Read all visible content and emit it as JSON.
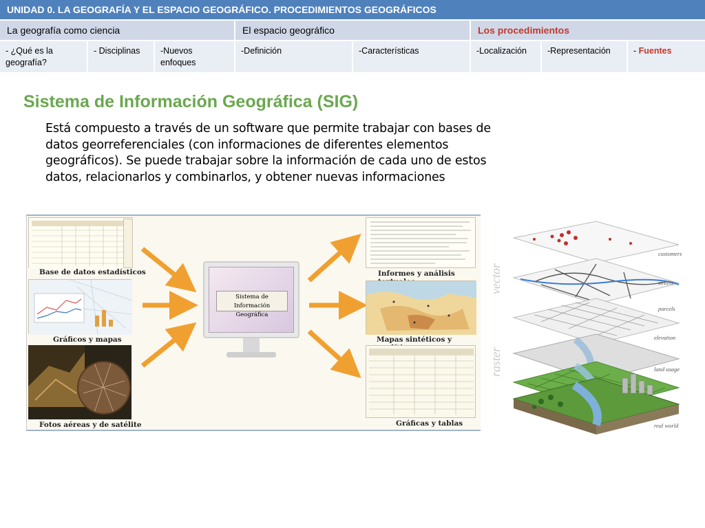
{
  "header": {
    "unit_title": "UNIDAD 0.  LA GEOGRAFÍA Y EL ESPACIO GEOGRÁFICO. PROCEDIMIENTOS GEOGRÁFICOS"
  },
  "sections": [
    {
      "label": "La geografía como ciencia"
    },
    {
      "label": "El espacio geográfico"
    },
    {
      "label": "Los procedimientos",
      "active": true
    }
  ],
  "subsections": [
    {
      "label": "- ¿Qué es la geografía?"
    },
    {
      "label": "- Disciplinas"
    },
    {
      "label": "-Nuevos enfoques"
    },
    {
      "label": "-Definición"
    },
    {
      "label": "-Características"
    },
    {
      "label": "-Localización"
    },
    {
      "label": "-Representación"
    },
    {
      "prefix": "- ",
      "label": "Fuentes",
      "active": true
    }
  ],
  "main": {
    "title": "Sistema de Información Geográfica (SIG)",
    "paragraph": "Está compuesto a través de un software que permite trabajar con bases de datos georreferenciales (con informaciones de diferentes elementos geográficos). Se puede trabajar sobre la información de cada uno de estos datos, relacionarlos y combinarlos, y obtener nuevas informaciones"
  },
  "diagram": {
    "center_label_line1": "Sistema de",
    "center_label_line2": "Información Geográfica",
    "inputs": [
      "Base de datos estadísticos",
      "Gráficos y mapas",
      "Fotos aéreas y de satélite"
    ],
    "outputs": [
      "Informes y análisis textuales",
      "Mapas sintéticos y analíticos",
      "Gráficas y tablas"
    ]
  },
  "layers": {
    "side_labels": [
      "vector",
      "raster"
    ],
    "labels": [
      "customers",
      "streets",
      "parcels",
      "elevation",
      "land usage",
      "real world"
    ]
  },
  "colors": {
    "header_bg": "#4f81bd",
    "section_bg": "#d0d8e8",
    "sub_bg": "#e9edf4",
    "active": "#c0392b",
    "title": "#6aa84f",
    "arrow": "#f0a030"
  }
}
